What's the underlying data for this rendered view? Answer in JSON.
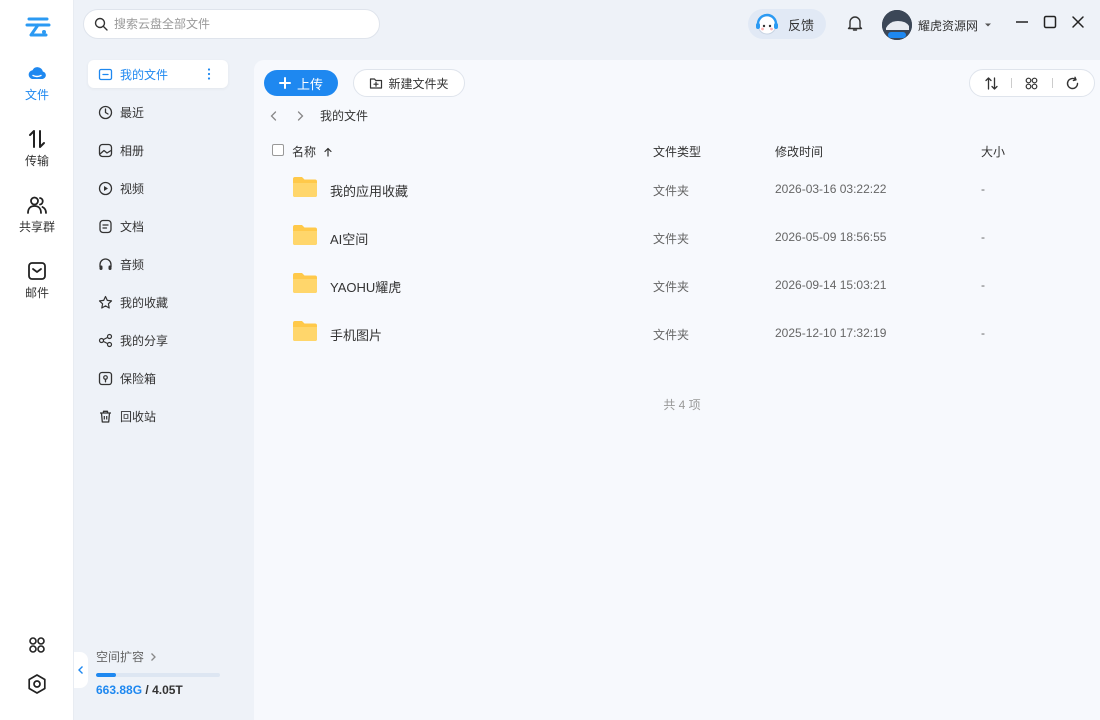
{
  "app": {
    "rail": [
      {
        "label": "文件",
        "icon": "cloud-icon",
        "active": true
      },
      {
        "label": "传输",
        "icon": "transfer-icon",
        "active": false
      },
      {
        "label": "共享群",
        "icon": "group-icon",
        "active": false
      },
      {
        "label": "邮件",
        "icon": "mail-icon",
        "active": false
      }
    ],
    "rail_bottom": [
      "apps-grid-icon",
      "settings-icon"
    ]
  },
  "topbar": {
    "search_placeholder": "搜索云盘全部文件",
    "feedback_label": "反馈",
    "username": "耀虎资源网"
  },
  "nav": {
    "items": [
      {
        "label": "我的文件",
        "icon": "folder-icon",
        "active": true
      },
      {
        "label": "最近",
        "icon": "clock-icon"
      },
      {
        "label": "相册",
        "icon": "album-icon"
      },
      {
        "label": "视频",
        "icon": "video-icon"
      },
      {
        "label": "文档",
        "icon": "document-icon"
      },
      {
        "label": "音频",
        "icon": "headphones-icon"
      },
      {
        "label": "我的收藏",
        "icon": "star-icon"
      },
      {
        "label": "我的分享",
        "icon": "share-icon"
      },
      {
        "label": "保险箱",
        "icon": "safe-icon"
      },
      {
        "label": "回收站",
        "icon": "trash-icon"
      }
    ],
    "storage": {
      "title": "空间扩容",
      "used": "663.88G",
      "total": "4.05T",
      "fraction": 0.16
    }
  },
  "toolbar": {
    "upload_label": "上传",
    "newfolder_label": "新建文件夹"
  },
  "breadcrumb": {
    "current": "我的文件"
  },
  "table": {
    "columns": {
      "name": "名称",
      "type": "文件类型",
      "modified": "修改时间",
      "size": "大小"
    },
    "rows": [
      {
        "name": "我的应用收藏",
        "type": "文件夹",
        "modified": "2026-03-16 03:22:22",
        "size": "-"
      },
      {
        "name": "AI空间",
        "type": "文件夹",
        "modified": "2026-05-09 18:56:55",
        "size": "-"
      },
      {
        "name": "YAOHU耀虎",
        "type": "文件夹",
        "modified": "2026-09-14 15:03:21",
        "size": "-"
      },
      {
        "name": "手机图片",
        "type": "文件夹",
        "modified": "2025-12-10 17:32:19",
        "size": "-"
      }
    ],
    "total_label": "共 4 项"
  },
  "colors": {
    "accent": "#1e88f0",
    "folder": "#ffc94a",
    "background": "#eef2f8"
  }
}
